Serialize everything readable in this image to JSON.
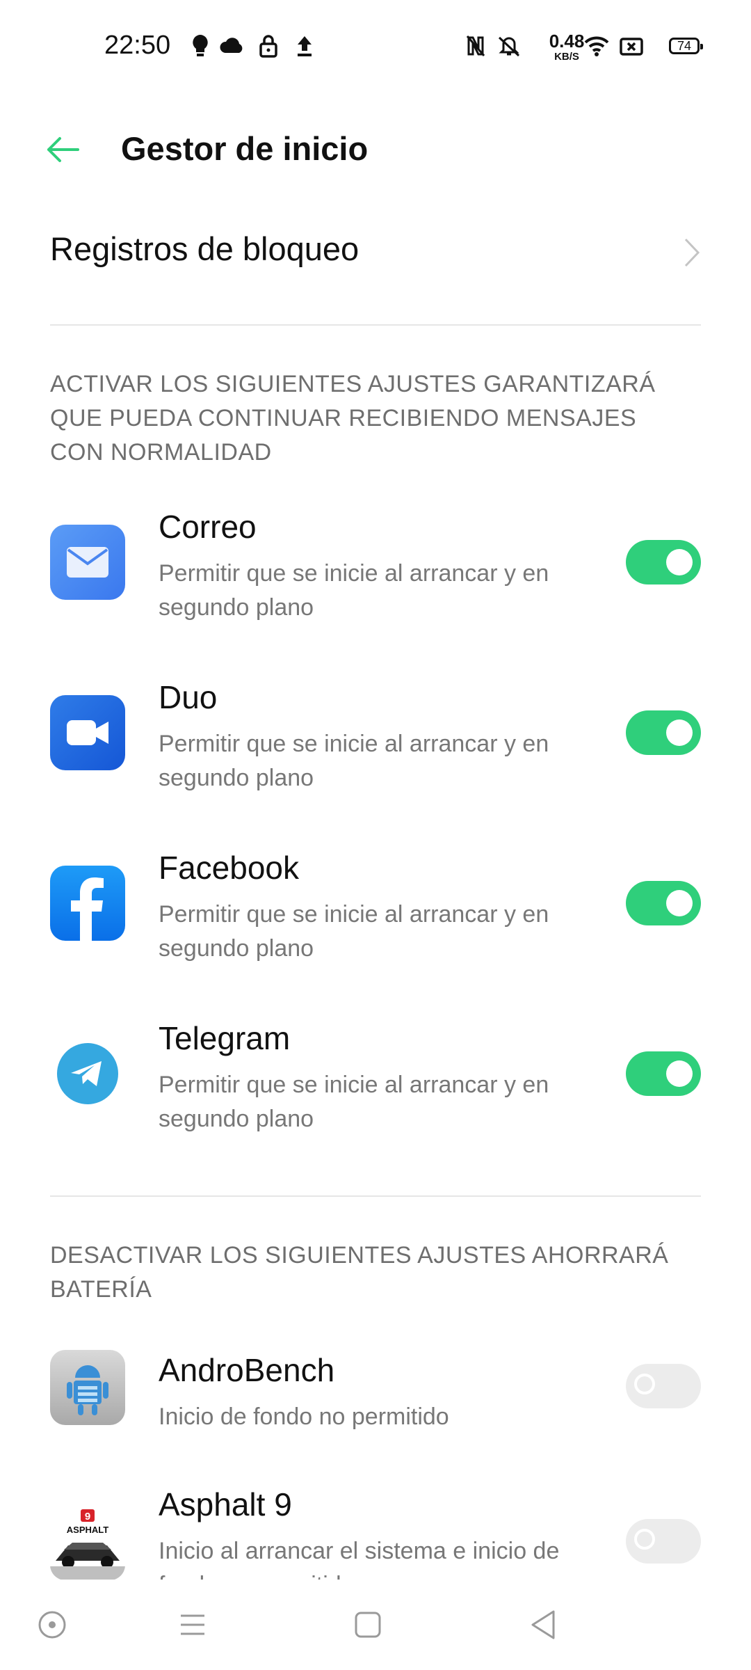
{
  "status_bar": {
    "time": "22:50",
    "net_speed_value": "0.48",
    "net_speed_unit": "KB/S",
    "battery": "74",
    "icons": [
      "bulb-icon",
      "cloud-icon",
      "lock-icon",
      "upload-icon",
      "nfc-icon",
      "vibrate-icon",
      "wifi-icon",
      "no-sim-icon",
      "battery-icon"
    ]
  },
  "header": {
    "title": "Gestor de inicio",
    "back_icon": "arrow-left-icon"
  },
  "block_log": {
    "label": "Registros de bloqueo"
  },
  "section_enabled": {
    "title": "ACTIVAR LOS SIGUIENTES AJUSTES GARANTIZARÁ QUE PUEDA CONTINUAR RECIBIENDO MENSAJES CON NORMALIDAD"
  },
  "section_disabled": {
    "title": "DESACTIVAR LOS SIGUIENTES AJUSTES AHORRARÁ BATERÍA"
  },
  "apps": [
    {
      "name": "Correo",
      "subtitle": "Permitir que se inicie al arrancar y en segundo plano",
      "enabled": true,
      "icon": "mail-icon"
    },
    {
      "name": "Duo",
      "subtitle": "Permitir que se inicie al arrancar y en segundo plano",
      "enabled": true,
      "icon": "video-camera-icon"
    },
    {
      "name": "Facebook",
      "subtitle": "Permitir que se inicie al arrancar y en segundo plano",
      "enabled": true,
      "icon": "facebook-icon"
    },
    {
      "name": "Telegram",
      "subtitle": "Permitir que se inicie al arrancar y en segundo plano",
      "enabled": true,
      "icon": "telegram-icon"
    },
    {
      "name": "AndroBench",
      "subtitle": "Inicio de fondo no permitido",
      "enabled": false,
      "icon": "androbench-icon"
    },
    {
      "name": "Asphalt 9",
      "subtitle": "Inicio al arrancar el sistema e inicio de fondo no permitido",
      "enabled": false,
      "icon": "asphalt-icon",
      "icon_badge": "9",
      "icon_text": "ASPHALT"
    }
  ],
  "colors": {
    "accent": "#2fcf7b",
    "back_arrow": "#2fcf7b",
    "section_text": "#6e6e6e"
  },
  "navbar": {
    "icons": [
      "screenshot-icon",
      "menu-icon",
      "home-icon",
      "back-icon"
    ]
  }
}
